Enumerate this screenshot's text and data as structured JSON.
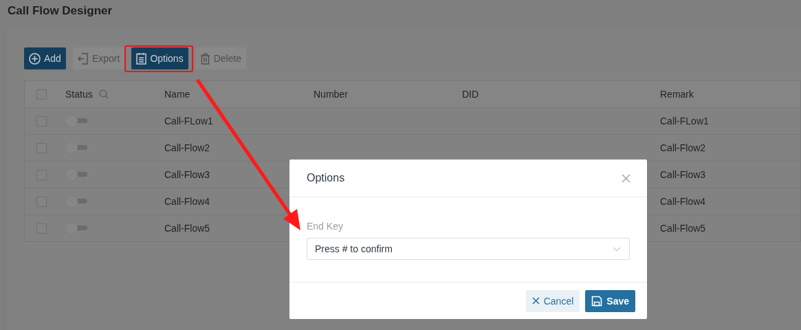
{
  "page": {
    "title": "Call Flow Designer"
  },
  "toolbar": [
    {
      "label": "Add",
      "disabled": false,
      "highlighted": false
    },
    {
      "label": "Export",
      "disabled": true,
      "highlighted": false
    },
    {
      "label": "Options",
      "disabled": false,
      "highlighted": true
    },
    {
      "label": "Delete",
      "disabled": true,
      "highlighted": false
    }
  ],
  "table": {
    "select_all_checked": false,
    "columns": [
      {
        "label": "Status"
      },
      {
        "label": "Name"
      },
      {
        "label": "Number"
      },
      {
        "label": "DID"
      },
      {
        "label": "Remark"
      }
    ],
    "rows": [
      {
        "checked": false,
        "on": false,
        "name": "Call-FLow1",
        "remark": "Call-FLow1"
      },
      {
        "checked": false,
        "on": false,
        "name": "Call-Flow2",
        "remark": "Call-Flow2"
      },
      {
        "checked": false,
        "on": false,
        "name": "Call-Flow3",
        "remark": "Call-Flow3"
      },
      {
        "checked": false,
        "on": false,
        "name": "Call-Flow4",
        "remark": "Call-Flow4"
      },
      {
        "checked": false,
        "on": false,
        "name": "Call-Flow5",
        "remark": "Call-Flow5"
      }
    ]
  },
  "dialog": {
    "title": "Options",
    "field": {
      "label": "End Key",
      "value": "Press # to confirm"
    },
    "buttons": [
      {
        "label": "Cancel",
        "kind": "secondary"
      },
      {
        "label": "Save",
        "kind": "primary"
      }
    ]
  }
}
